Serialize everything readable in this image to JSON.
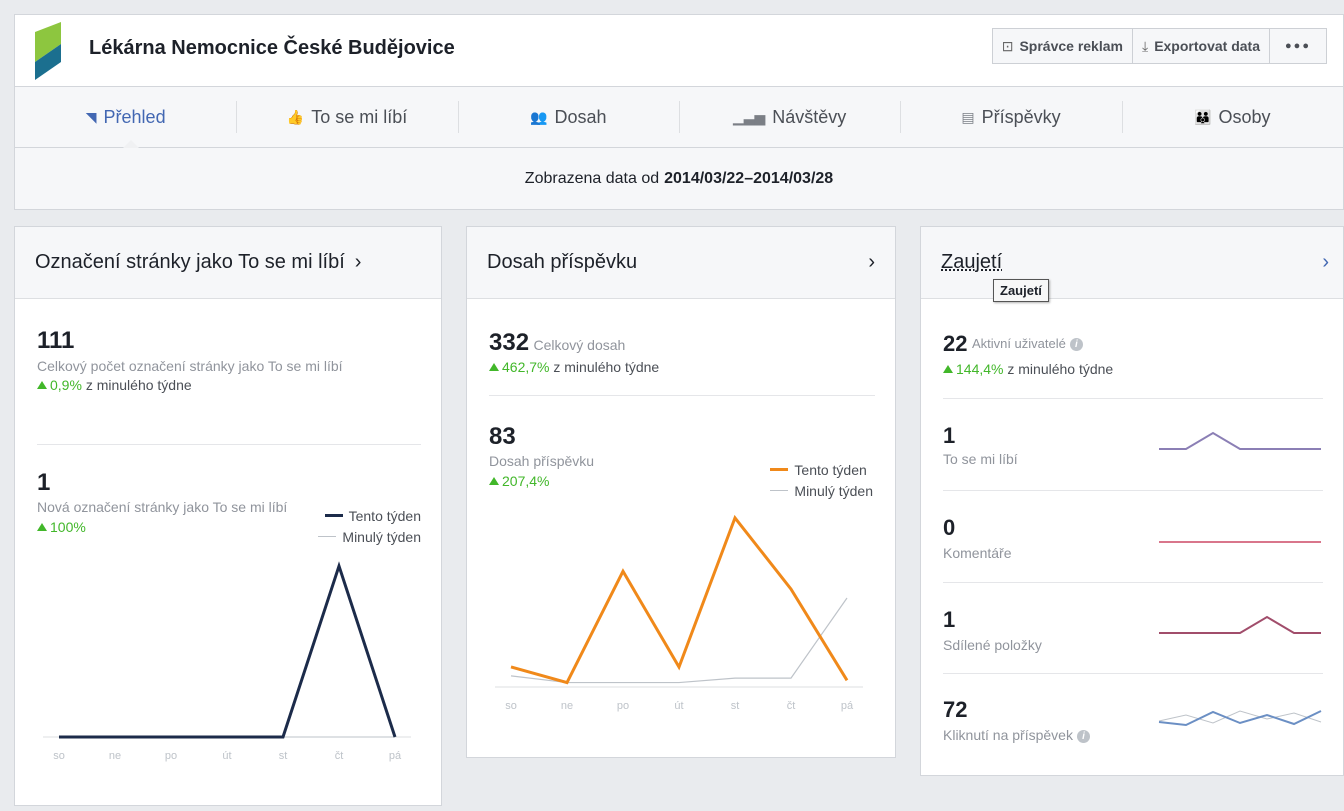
{
  "header": {
    "page_name": "Lékárna Nemocnice České Budějovice",
    "ads_manager_label": "Správce reklam",
    "export_label": "Exportovat data",
    "more_label": "●●●"
  },
  "tabs": [
    {
      "label": "Přehled",
      "icon": "flag-icon",
      "active": true
    },
    {
      "label": "To se mi líbí",
      "icon": "thumbs-up-icon"
    },
    {
      "label": "Dosah",
      "icon": "people-icon"
    },
    {
      "label": "Návštěvy",
      "icon": "bar-chart-icon"
    },
    {
      "label": "Příspěvky",
      "icon": "posts-icon"
    },
    {
      "label": "Osoby",
      "icon": "group-icon"
    }
  ],
  "date_range": {
    "prefix": "Zobrazena data od",
    "range": "2014/03/22–2014/03/28"
  },
  "colors": {
    "accent": "#4267b2",
    "positive": "#42b72a",
    "this_week_likes": "#1c2b4a",
    "this_week_reach": "#f0891a",
    "last_week": "#bec3c9"
  },
  "likes_card": {
    "title": "Označení stránky jako To se mi líbí",
    "chevron": "›",
    "total_value": "111",
    "total_label": "Celkový počet označení stránky jako To se mi líbí",
    "total_change": "0,9%",
    "change_suffix": "z minulého týdne",
    "new_value": "1",
    "new_label": "Nová označení stránky jako To se mi líbí",
    "new_change": "100%",
    "legend_this": "Tento týden",
    "legend_last": "Minulý týden"
  },
  "reach_card": {
    "title": "Dosah příspěvku",
    "chevron": "›",
    "total_value": "332",
    "total_label": "Celkový dosah",
    "total_change": "462,7%",
    "change_suffix": "z minulého týdne",
    "post_value": "83",
    "post_label": "Dosah příspěvku",
    "post_change": "207,4%",
    "legend_this": "Tento týden",
    "legend_last": "Minulý týden"
  },
  "engagement_card": {
    "title": "Zaujetí",
    "chevron": "›",
    "tooltip": "Zaujetí",
    "active_value": "22",
    "active_label": "Aktivní uživatelé",
    "active_change": "144,4%",
    "change_suffix": "z minulého týdne",
    "metrics": [
      {
        "value": "1",
        "label": "To se mi líbí",
        "info": false,
        "color": "#8b7fb5"
      },
      {
        "value": "0",
        "label": "Komentáře",
        "info": false,
        "color": "#d9768b"
      },
      {
        "value": "1",
        "label": "Sdílené položky",
        "info": false,
        "color": "#a14d6b"
      },
      {
        "value": "72",
        "label": "Kliknutí na příspěvek",
        "info": true,
        "color": "#6b8fc4"
      }
    ]
  },
  "chart_data": [
    {
      "type": "line",
      "x": [
        "so",
        "ne",
        "po",
        "út",
        "st",
        "čt",
        "pá"
      ],
      "series": [
        {
          "name": "Tento týden",
          "values": [
            0,
            0,
            0,
            0,
            0,
            1,
            0
          ]
        },
        {
          "name": "Minulý týden",
          "values": [
            0,
            0,
            0,
            0,
            0,
            0,
            0
          ]
        }
      ],
      "ylim": [
        0,
        1.1
      ],
      "grid": false
    },
    {
      "type": "line",
      "x": [
        "so",
        "ne",
        "po",
        "út",
        "st",
        "čt",
        "pá"
      ],
      "series": [
        {
          "name": "Tento týden",
          "values": [
            9,
            2,
            52,
            9,
            76,
            44,
            3
          ]
        },
        {
          "name": "Minulý týden",
          "values": [
            5,
            2,
            2,
            2,
            4,
            4,
            40
          ]
        }
      ],
      "ylim": [
        0,
        80
      ],
      "grid": false
    }
  ],
  "sparklines": {
    "likes": [
      0,
      0,
      1,
      0,
      0,
      0,
      0
    ],
    "comments": [
      0,
      0,
      0,
      0,
      0,
      0,
      0
    ],
    "shares": [
      0,
      0,
      0,
      0,
      1,
      0,
      0
    ],
    "clicks": [
      8,
      5,
      18,
      7,
      15,
      6,
      19
    ]
  }
}
